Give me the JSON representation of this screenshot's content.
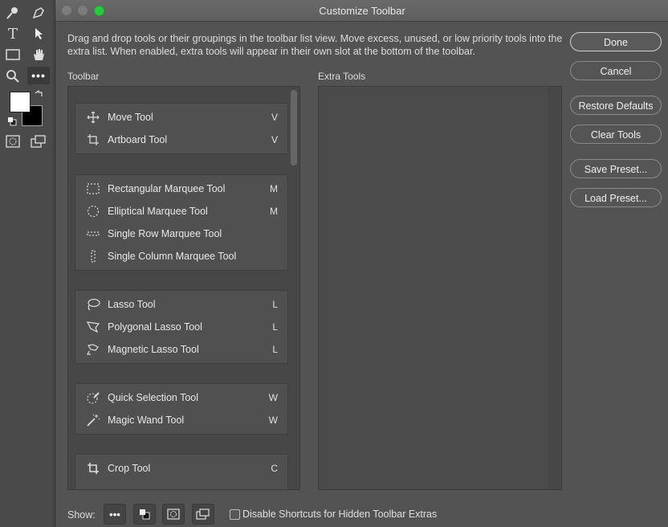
{
  "window": {
    "title": "Customize Toolbar"
  },
  "description": "Drag and drop tools or their groupings in the toolbar list view. Move excess, unused, or low priority tools into the extra list. When enabled, extra tools will appear in their own slot at the bottom of the toolbar.",
  "labels": {
    "toolbar": "Toolbar",
    "extra_tools": "Extra Tools"
  },
  "groups": [
    {
      "tools": [
        {
          "name": "Move Tool",
          "key": "V",
          "icon": "move-icon"
        },
        {
          "name": "Artboard Tool",
          "key": "V",
          "icon": "artboard-icon"
        }
      ]
    },
    {
      "tools": [
        {
          "name": "Rectangular Marquee Tool",
          "key": "M",
          "icon": "rect-marquee-icon"
        },
        {
          "name": "Elliptical Marquee Tool",
          "key": "M",
          "icon": "ellipse-marquee-icon"
        },
        {
          "name": "Single Row Marquee Tool",
          "key": "",
          "icon": "row-marquee-icon"
        },
        {
          "name": "Single Column Marquee Tool",
          "key": "",
          "icon": "column-marquee-icon"
        }
      ]
    },
    {
      "tools": [
        {
          "name": "Lasso Tool",
          "key": "L",
          "icon": "lasso-icon"
        },
        {
          "name": "Polygonal Lasso Tool",
          "key": "L",
          "icon": "polygonal-lasso-icon"
        },
        {
          "name": "Magnetic Lasso Tool",
          "key": "L",
          "icon": "magnetic-lasso-icon"
        }
      ]
    },
    {
      "tools": [
        {
          "name": "Quick Selection Tool",
          "key": "W",
          "icon": "quick-selection-icon"
        },
        {
          "name": "Magic Wand Tool",
          "key": "W",
          "icon": "magic-wand-icon"
        }
      ]
    },
    {
      "tools": [
        {
          "name": "Crop Tool",
          "key": "C",
          "icon": "crop-icon"
        }
      ]
    }
  ],
  "buttons": {
    "done": "Done",
    "cancel": "Cancel",
    "restore": "Restore Defaults",
    "clear": "Clear Tools",
    "save_preset": "Save Preset...",
    "load_preset": "Load Preset..."
  },
  "bottom": {
    "show_label": "Show:",
    "more_glyph": "•••",
    "checkbox_label": "Disable Shortcuts for Hidden Toolbar Extras",
    "checkbox_checked": false
  },
  "ps_toolbar": {
    "more_glyph": "•••",
    "type_glyph": "T"
  }
}
